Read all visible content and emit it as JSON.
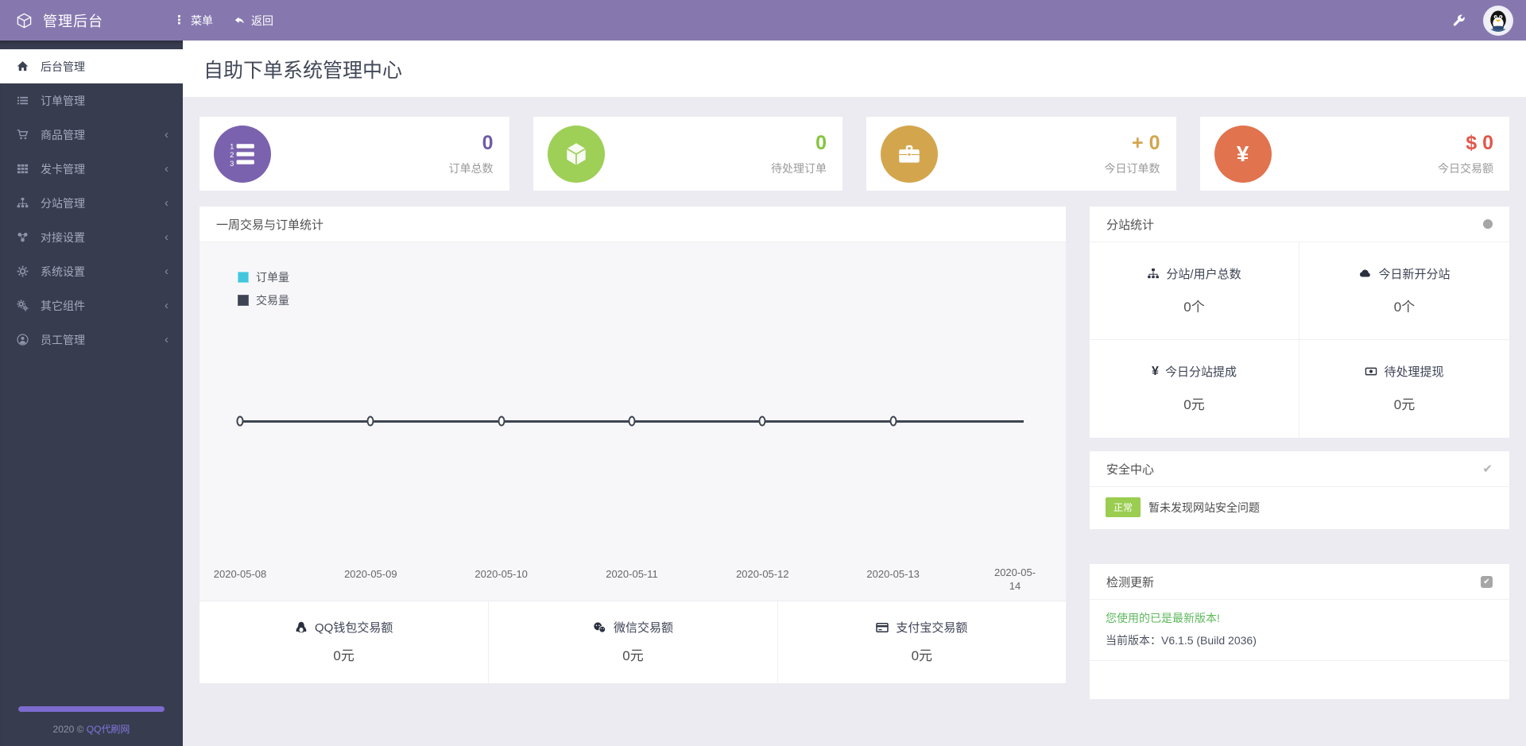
{
  "topbar": {
    "brand": "管理后台",
    "menu_label": "菜单",
    "back_label": "返回"
  },
  "sidebar": {
    "items": [
      {
        "label": "后台管理"
      },
      {
        "label": "订单管理"
      },
      {
        "label": "商品管理"
      },
      {
        "label": "发卡管理"
      },
      {
        "label": "分站管理"
      },
      {
        "label": "对接设置"
      },
      {
        "label": "系统设置"
      },
      {
        "label": "其它组件"
      },
      {
        "label": "员工管理"
      }
    ],
    "footer": {
      "year_text": "2020 ©",
      "site_name": "QQ代刷网"
    }
  },
  "page": {
    "title": "自助下单系统管理中心"
  },
  "stat_cards": [
    {
      "label": "订单总数",
      "value": "0",
      "icon": "ordered-list-icon",
      "circle_color": "#7b62ae",
      "value_color": "#6f5ba8",
      "icon_digits": [
        "1",
        "2",
        "3"
      ]
    },
    {
      "label": "待处理订单",
      "value": "0",
      "icon": "cube-icon",
      "circle_color": "#9ecf57",
      "value_color": "#85c43d"
    },
    {
      "label": "今日订单数",
      "value": "+ 0",
      "icon": "briefcase-icon",
      "circle_color": "#d3a64e",
      "value_color": "#d3a64e"
    },
    {
      "label": "今日交易额",
      "value": "$ 0",
      "icon": "yen-icon",
      "icon_glyph": "¥",
      "circle_color": "#e1734f",
      "value_color": "#e2574c"
    }
  ],
  "chart_panel": {
    "title": "一周交易与订单统计",
    "legend": [
      {
        "label": "订单量",
        "color": "#41c7dd"
      },
      {
        "label": "交易量",
        "color": "#3e4452"
      }
    ]
  },
  "chart_data": {
    "type": "line",
    "title": "一周交易与订单统计",
    "x": [
      "2020-05-08",
      "2020-05-09",
      "2020-05-10",
      "2020-05-11",
      "2020-05-12",
      "2020-05-13",
      "2020-05-14"
    ],
    "series": [
      {
        "name": "订单量",
        "values": [
          0,
          0,
          0,
          0,
          0,
          0,
          0
        ]
      },
      {
        "name": "交易量",
        "values": [
          0,
          0,
          0,
          0,
          0,
          0,
          0
        ]
      }
    ],
    "xlabel": "",
    "ylabel": "",
    "legend_position": "top-left",
    "grid": false,
    "line_color": "#3e4452",
    "marker": "open-circle"
  },
  "payment_totals": [
    {
      "label": "QQ钱包交易额",
      "value": "0元",
      "icon": "qq-penguin-icon"
    },
    {
      "label": "微信交易额",
      "value": "0元",
      "icon": "wechat-icon"
    },
    {
      "label": "支付宝交易额",
      "value": "0元",
      "icon": "credit-card-icon"
    }
  ],
  "substation_panel": {
    "title": "分站统计",
    "cells": [
      {
        "label": "分站/用户总数",
        "value": "0个",
        "icon": "sitemap-icon"
      },
      {
        "label": "今日新开分站",
        "value": "0个",
        "icon": "cloud-icon"
      },
      {
        "label": "今日分站提成",
        "value": "0元",
        "icon": "yen-icon",
        "icon_glyph": "¥"
      },
      {
        "label": "待处理提现",
        "value": "0元",
        "icon": "money-icon"
      }
    ]
  },
  "security_panel": {
    "title": "安全中心",
    "badge": "正常",
    "badge_color": "#9acd50",
    "message": "暂未发现网站安全问题"
  },
  "update_panel": {
    "title": "检测更新",
    "status": "您使用的已是最新版本!",
    "status_color": "#5cb85c",
    "version_label": "当前版本：",
    "version": "V6.1.5 (Build 2036)"
  },
  "ui": {
    "chevron": "‹",
    "menu_dots": "⋮",
    "check": "✔"
  }
}
